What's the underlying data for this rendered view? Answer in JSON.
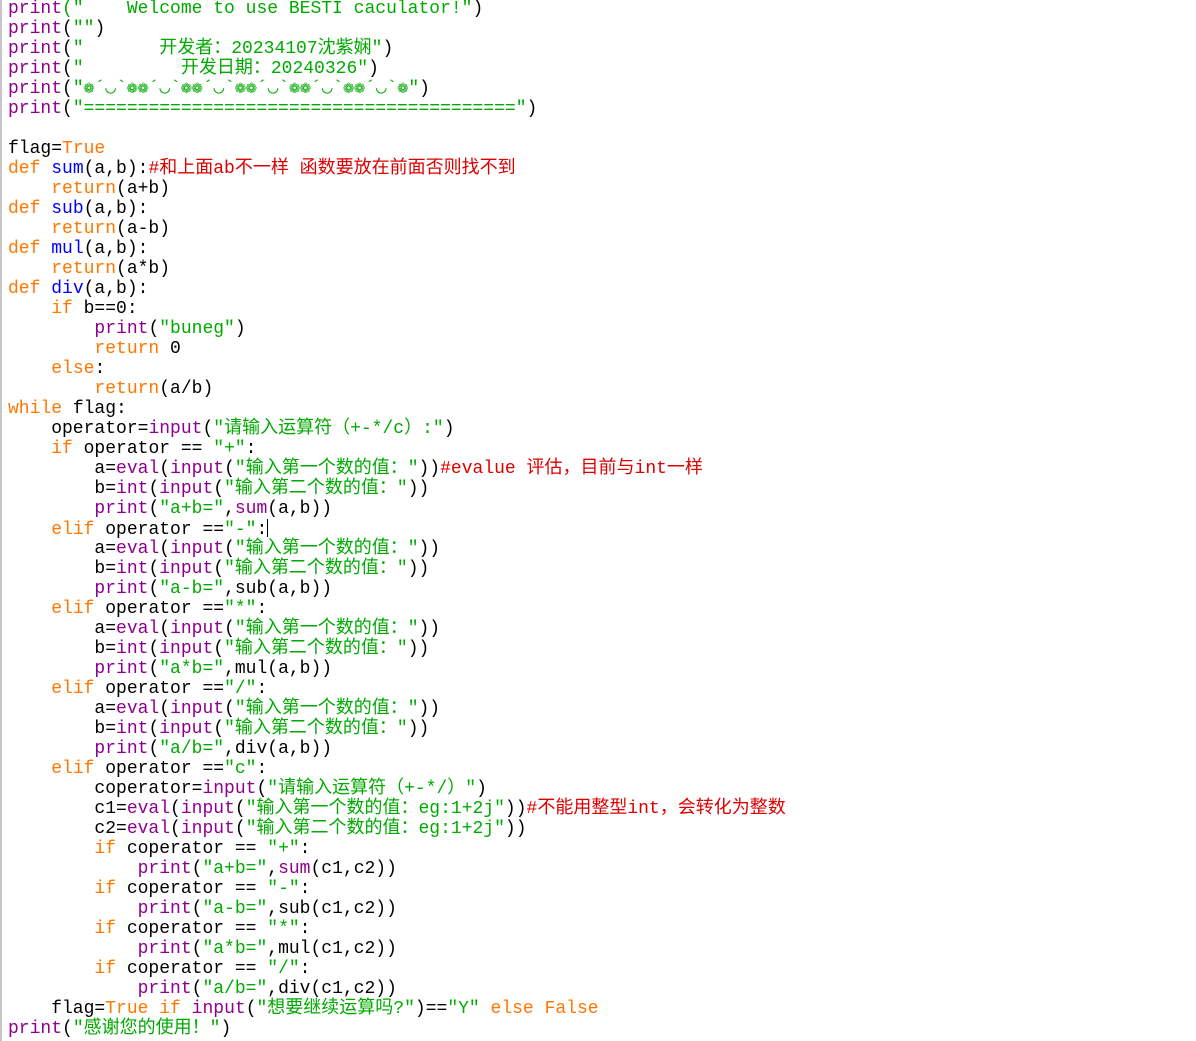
{
  "colors": {
    "keyword": "#ff7700",
    "builtin": "#900090",
    "string": "#00aa00",
    "comment": "#dd0000",
    "definition": "#0000ff",
    "plain": "#000000"
  },
  "lines": [
    [
      {
        "t": "print",
        "c": "builtin"
      },
      {
        "t": "(\"    Welcome to use BESTI caculator!\"",
        "c": "string"
      },
      {
        "t": ")",
        "c": "plain"
      }
    ],
    [
      {
        "t": "print",
        "c": "builtin"
      },
      {
        "t": "(",
        "c": "plain"
      },
      {
        "t": "\"\"",
        "c": "string"
      },
      {
        "t": ")",
        "c": "plain"
      }
    ],
    [
      {
        "t": "print",
        "c": "builtin"
      },
      {
        "t": "(",
        "c": "plain"
      },
      {
        "t": "\"       开发者：20234107沈紫娴\"",
        "c": "string"
      },
      {
        "t": ")",
        "c": "plain"
      }
    ],
    [
      {
        "t": "print",
        "c": "builtin"
      },
      {
        "t": "(",
        "c": "plain"
      },
      {
        "t": "\"         开发日期：20240326\"",
        "c": "string"
      },
      {
        "t": ")",
        "c": "plain"
      }
    ],
    [
      {
        "t": "print",
        "c": "builtin"
      },
      {
        "t": "(",
        "c": "plain"
      },
      {
        "t": "\"❁´◡`❁❁´◡`❁❁´◡`❁❁´◡`❁❁´◡`❁❁´◡`❁\"",
        "c": "string"
      },
      {
        "t": ")",
        "c": "plain"
      }
    ],
    [
      {
        "t": "print",
        "c": "builtin"
      },
      {
        "t": "(",
        "c": "plain"
      },
      {
        "t": "\"========================================\"",
        "c": "string"
      },
      {
        "t": ")",
        "c": "plain"
      }
    ],
    [],
    [
      {
        "t": "flag=",
        "c": "plain"
      },
      {
        "t": "True",
        "c": "keyword"
      }
    ],
    [
      {
        "t": "def ",
        "c": "keyword"
      },
      {
        "t": "sum",
        "c": "definition"
      },
      {
        "t": "(a,b):",
        "c": "plain"
      },
      {
        "t": "#和上面ab不一样 函数要放在前面否则找不到",
        "c": "comment"
      }
    ],
    [
      {
        "t": "    ",
        "c": "plain"
      },
      {
        "t": "return",
        "c": "keyword"
      },
      {
        "t": "(a+b)",
        "c": "plain"
      }
    ],
    [
      {
        "t": "def ",
        "c": "keyword"
      },
      {
        "t": "sub",
        "c": "definition"
      },
      {
        "t": "(a,b):",
        "c": "plain"
      }
    ],
    [
      {
        "t": "    ",
        "c": "plain"
      },
      {
        "t": "return",
        "c": "keyword"
      },
      {
        "t": "(a-b)",
        "c": "plain"
      }
    ],
    [
      {
        "t": "def ",
        "c": "keyword"
      },
      {
        "t": "mul",
        "c": "definition"
      },
      {
        "t": "(a,b):",
        "c": "plain"
      }
    ],
    [
      {
        "t": "    ",
        "c": "plain"
      },
      {
        "t": "return",
        "c": "keyword"
      },
      {
        "t": "(a*b)",
        "c": "plain"
      }
    ],
    [
      {
        "t": "def ",
        "c": "keyword"
      },
      {
        "t": "div",
        "c": "definition"
      },
      {
        "t": "(a,b):",
        "c": "plain"
      }
    ],
    [
      {
        "t": "    ",
        "c": "plain"
      },
      {
        "t": "if",
        "c": "keyword"
      },
      {
        "t": " b==0:",
        "c": "plain"
      }
    ],
    [
      {
        "t": "        ",
        "c": "plain"
      },
      {
        "t": "print",
        "c": "builtin"
      },
      {
        "t": "(",
        "c": "plain"
      },
      {
        "t": "\"buneg\"",
        "c": "string"
      },
      {
        "t": ")",
        "c": "plain"
      }
    ],
    [
      {
        "t": "        ",
        "c": "plain"
      },
      {
        "t": "return",
        "c": "keyword"
      },
      {
        "t": " 0",
        "c": "plain"
      }
    ],
    [
      {
        "t": "    ",
        "c": "plain"
      },
      {
        "t": "else",
        "c": "keyword"
      },
      {
        "t": ":",
        "c": "plain"
      }
    ],
    [
      {
        "t": "        ",
        "c": "plain"
      },
      {
        "t": "return",
        "c": "keyword"
      },
      {
        "t": "(a/b)",
        "c": "plain"
      }
    ],
    [
      {
        "t": "while",
        "c": "keyword"
      },
      {
        "t": " flag:",
        "c": "plain"
      }
    ],
    [
      {
        "t": "    operator=",
        "c": "plain"
      },
      {
        "t": "input",
        "c": "builtin"
      },
      {
        "t": "(",
        "c": "plain"
      },
      {
        "t": "\"请输入运算符（+-*/c）:\"",
        "c": "string"
      },
      {
        "t": ")",
        "c": "plain"
      }
    ],
    [
      {
        "t": "    ",
        "c": "plain"
      },
      {
        "t": "if",
        "c": "keyword"
      },
      {
        "t": " operator == ",
        "c": "plain"
      },
      {
        "t": "\"+\"",
        "c": "string"
      },
      {
        "t": ":",
        "c": "plain"
      }
    ],
    [
      {
        "t": "        a=",
        "c": "plain"
      },
      {
        "t": "eval",
        "c": "builtin"
      },
      {
        "t": "(",
        "c": "plain"
      },
      {
        "t": "input",
        "c": "builtin"
      },
      {
        "t": "(",
        "c": "plain"
      },
      {
        "t": "\"输入第一个数的值：\"",
        "c": "string"
      },
      {
        "t": "))",
        "c": "plain"
      },
      {
        "t": "#evalue 评估，目前与int一样",
        "c": "comment"
      }
    ],
    [
      {
        "t": "        b=",
        "c": "plain"
      },
      {
        "t": "int",
        "c": "builtin"
      },
      {
        "t": "(",
        "c": "plain"
      },
      {
        "t": "input",
        "c": "builtin"
      },
      {
        "t": "(",
        "c": "plain"
      },
      {
        "t": "\"输入第二个数的值：\"",
        "c": "string"
      },
      {
        "t": "))",
        "c": "plain"
      }
    ],
    [
      {
        "t": "        ",
        "c": "plain"
      },
      {
        "t": "print",
        "c": "builtin"
      },
      {
        "t": "(",
        "c": "plain"
      },
      {
        "t": "\"a+b=\"",
        "c": "string"
      },
      {
        "t": ",",
        "c": "plain"
      },
      {
        "t": "sum",
        "c": "builtin"
      },
      {
        "t": "(a,b))",
        "c": "plain"
      }
    ],
    [
      {
        "t": "    ",
        "c": "plain"
      },
      {
        "t": "elif",
        "c": "keyword"
      },
      {
        "t": " operator ==",
        "c": "plain"
      },
      {
        "t": "\"-\"",
        "c": "string"
      },
      {
        "t": ":",
        "c": "plain"
      },
      {
        "t": "",
        "c": "caret"
      }
    ],
    [
      {
        "t": "        a=",
        "c": "plain"
      },
      {
        "t": "eval",
        "c": "builtin"
      },
      {
        "t": "(",
        "c": "plain"
      },
      {
        "t": "input",
        "c": "builtin"
      },
      {
        "t": "(",
        "c": "plain"
      },
      {
        "t": "\"输入第一个数的值：\"",
        "c": "string"
      },
      {
        "t": "))",
        "c": "plain"
      }
    ],
    [
      {
        "t": "        b=",
        "c": "plain"
      },
      {
        "t": "int",
        "c": "builtin"
      },
      {
        "t": "(",
        "c": "plain"
      },
      {
        "t": "input",
        "c": "builtin"
      },
      {
        "t": "(",
        "c": "plain"
      },
      {
        "t": "\"输入第二个数的值：\"",
        "c": "string"
      },
      {
        "t": "))",
        "c": "plain"
      }
    ],
    [
      {
        "t": "        ",
        "c": "plain"
      },
      {
        "t": "print",
        "c": "builtin"
      },
      {
        "t": "(",
        "c": "plain"
      },
      {
        "t": "\"a-b=\"",
        "c": "string"
      },
      {
        "t": ",sub(a,b))",
        "c": "plain"
      }
    ],
    [
      {
        "t": "    ",
        "c": "plain"
      },
      {
        "t": "elif",
        "c": "keyword"
      },
      {
        "t": " operator ==",
        "c": "plain"
      },
      {
        "t": "\"*\"",
        "c": "string"
      },
      {
        "t": ":",
        "c": "plain"
      }
    ],
    [
      {
        "t": "        a=",
        "c": "plain"
      },
      {
        "t": "eval",
        "c": "builtin"
      },
      {
        "t": "(",
        "c": "plain"
      },
      {
        "t": "input",
        "c": "builtin"
      },
      {
        "t": "(",
        "c": "plain"
      },
      {
        "t": "\"输入第一个数的值：\"",
        "c": "string"
      },
      {
        "t": "))",
        "c": "plain"
      }
    ],
    [
      {
        "t": "        b=",
        "c": "plain"
      },
      {
        "t": "int",
        "c": "builtin"
      },
      {
        "t": "(",
        "c": "plain"
      },
      {
        "t": "input",
        "c": "builtin"
      },
      {
        "t": "(",
        "c": "plain"
      },
      {
        "t": "\"输入第二个数的值：\"",
        "c": "string"
      },
      {
        "t": "))",
        "c": "plain"
      }
    ],
    [
      {
        "t": "        ",
        "c": "plain"
      },
      {
        "t": "print",
        "c": "builtin"
      },
      {
        "t": "(",
        "c": "plain"
      },
      {
        "t": "\"a*b=\"",
        "c": "string"
      },
      {
        "t": ",mul(a,b))",
        "c": "plain"
      }
    ],
    [
      {
        "t": "    ",
        "c": "plain"
      },
      {
        "t": "elif",
        "c": "keyword"
      },
      {
        "t": " operator ==",
        "c": "plain"
      },
      {
        "t": "\"/\"",
        "c": "string"
      },
      {
        "t": ":",
        "c": "plain"
      }
    ],
    [
      {
        "t": "        a=",
        "c": "plain"
      },
      {
        "t": "eval",
        "c": "builtin"
      },
      {
        "t": "(",
        "c": "plain"
      },
      {
        "t": "input",
        "c": "builtin"
      },
      {
        "t": "(",
        "c": "plain"
      },
      {
        "t": "\"输入第一个数的值：\"",
        "c": "string"
      },
      {
        "t": "))",
        "c": "plain"
      }
    ],
    [
      {
        "t": "        b=",
        "c": "plain"
      },
      {
        "t": "int",
        "c": "builtin"
      },
      {
        "t": "(",
        "c": "plain"
      },
      {
        "t": "input",
        "c": "builtin"
      },
      {
        "t": "(",
        "c": "plain"
      },
      {
        "t": "\"输入第二个数的值：\"",
        "c": "string"
      },
      {
        "t": "))",
        "c": "plain"
      }
    ],
    [
      {
        "t": "        ",
        "c": "plain"
      },
      {
        "t": "print",
        "c": "builtin"
      },
      {
        "t": "(",
        "c": "plain"
      },
      {
        "t": "\"a/b=\"",
        "c": "string"
      },
      {
        "t": ",div(a,b))",
        "c": "plain"
      }
    ],
    [
      {
        "t": "    ",
        "c": "plain"
      },
      {
        "t": "elif",
        "c": "keyword"
      },
      {
        "t": " operator ==",
        "c": "plain"
      },
      {
        "t": "\"c\"",
        "c": "string"
      },
      {
        "t": ":",
        "c": "plain"
      }
    ],
    [
      {
        "t": "        coperator=",
        "c": "plain"
      },
      {
        "t": "input",
        "c": "builtin"
      },
      {
        "t": "(",
        "c": "plain"
      },
      {
        "t": "\"请输入运算符（+-*/）\"",
        "c": "string"
      },
      {
        "t": ")",
        "c": "plain"
      }
    ],
    [
      {
        "t": "        c1=",
        "c": "plain"
      },
      {
        "t": "eval",
        "c": "builtin"
      },
      {
        "t": "(",
        "c": "plain"
      },
      {
        "t": "input",
        "c": "builtin"
      },
      {
        "t": "(",
        "c": "plain"
      },
      {
        "t": "\"输入第一个数的值：eg:1+2j\"",
        "c": "string"
      },
      {
        "t": "))",
        "c": "plain"
      },
      {
        "t": "#不能用整型int，会转化为整数",
        "c": "comment"
      }
    ],
    [
      {
        "t": "        c2=",
        "c": "plain"
      },
      {
        "t": "eval",
        "c": "builtin"
      },
      {
        "t": "(",
        "c": "plain"
      },
      {
        "t": "input",
        "c": "builtin"
      },
      {
        "t": "(",
        "c": "plain"
      },
      {
        "t": "\"输入第二个数的值：eg:1+2j\"",
        "c": "string"
      },
      {
        "t": "))",
        "c": "plain"
      }
    ],
    [
      {
        "t": "        ",
        "c": "plain"
      },
      {
        "t": "if",
        "c": "keyword"
      },
      {
        "t": " coperator == ",
        "c": "plain"
      },
      {
        "t": "\"+\"",
        "c": "string"
      },
      {
        "t": ":",
        "c": "plain"
      }
    ],
    [
      {
        "t": "            ",
        "c": "plain"
      },
      {
        "t": "print",
        "c": "builtin"
      },
      {
        "t": "(",
        "c": "plain"
      },
      {
        "t": "\"a+b=\"",
        "c": "string"
      },
      {
        "t": ",",
        "c": "plain"
      },
      {
        "t": "sum",
        "c": "builtin"
      },
      {
        "t": "(c1,c2))",
        "c": "plain"
      }
    ],
    [
      {
        "t": "        ",
        "c": "plain"
      },
      {
        "t": "if",
        "c": "keyword"
      },
      {
        "t": " coperator == ",
        "c": "plain"
      },
      {
        "t": "\"-\"",
        "c": "string"
      },
      {
        "t": ":",
        "c": "plain"
      }
    ],
    [
      {
        "t": "            ",
        "c": "plain"
      },
      {
        "t": "print",
        "c": "builtin"
      },
      {
        "t": "(",
        "c": "plain"
      },
      {
        "t": "\"a-b=\"",
        "c": "string"
      },
      {
        "t": ",sub(c1,c2))",
        "c": "plain"
      }
    ],
    [
      {
        "t": "        ",
        "c": "plain"
      },
      {
        "t": "if",
        "c": "keyword"
      },
      {
        "t": " coperator == ",
        "c": "plain"
      },
      {
        "t": "\"*\"",
        "c": "string"
      },
      {
        "t": ":",
        "c": "plain"
      }
    ],
    [
      {
        "t": "            ",
        "c": "plain"
      },
      {
        "t": "print",
        "c": "builtin"
      },
      {
        "t": "(",
        "c": "plain"
      },
      {
        "t": "\"a*b=\"",
        "c": "string"
      },
      {
        "t": ",mul(c1,c2))",
        "c": "plain"
      }
    ],
    [
      {
        "t": "        ",
        "c": "plain"
      },
      {
        "t": "if",
        "c": "keyword"
      },
      {
        "t": " coperator == ",
        "c": "plain"
      },
      {
        "t": "\"/\"",
        "c": "string"
      },
      {
        "t": ":",
        "c": "plain"
      }
    ],
    [
      {
        "t": "            ",
        "c": "plain"
      },
      {
        "t": "print",
        "c": "builtin"
      },
      {
        "t": "(",
        "c": "plain"
      },
      {
        "t": "\"a/b=\"",
        "c": "string"
      },
      {
        "t": ",div(c1,c2))",
        "c": "plain"
      }
    ],
    [
      {
        "t": "    flag=",
        "c": "plain"
      },
      {
        "t": "True",
        "c": "keyword"
      },
      {
        "t": " ",
        "c": "plain"
      },
      {
        "t": "if",
        "c": "keyword"
      },
      {
        "t": " ",
        "c": "plain"
      },
      {
        "t": "input",
        "c": "builtin"
      },
      {
        "t": "(",
        "c": "plain"
      },
      {
        "t": "\"想要继续运算吗?\"",
        "c": "string"
      },
      {
        "t": ")==",
        "c": "plain"
      },
      {
        "t": "\"Y\"",
        "c": "string"
      },
      {
        "t": " ",
        "c": "plain"
      },
      {
        "t": "else",
        "c": "keyword"
      },
      {
        "t": " ",
        "c": "plain"
      },
      {
        "t": "False",
        "c": "keyword"
      }
    ],
    [
      {
        "t": "print",
        "c": "builtin"
      },
      {
        "t": "(",
        "c": "plain"
      },
      {
        "t": "\"感谢您的使用！\"",
        "c": "string"
      },
      {
        "t": ")",
        "c": "plain"
      }
    ]
  ]
}
